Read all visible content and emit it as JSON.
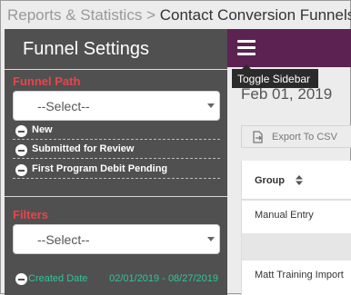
{
  "breadcrumb": {
    "parent": "Reports & Statistics",
    "separator": ">",
    "current": "Contact Conversion Funnels"
  },
  "sidebar": {
    "title": "Funnel Settings",
    "funnel_path": {
      "label": "Funnel Path",
      "select_value": "--Select--",
      "items": [
        {
          "label": "New"
        },
        {
          "label": "Submitted for Review"
        },
        {
          "label": "First Program Debit Pending"
        }
      ]
    },
    "filters": {
      "label": "Filters",
      "select_value": "--Select--",
      "items": [
        {
          "label": "Created Date",
          "value": "02/01/2019 - 08/27/2019"
        }
      ]
    }
  },
  "topbar": {
    "tooltip": "Toggle Sidebar"
  },
  "main": {
    "date_title": "Feb 01, 2019",
    "export_label": "Export To CSV",
    "table": {
      "header": "Group",
      "rows": [
        "Manual Entry",
        "",
        "Matt Training Import"
      ]
    }
  },
  "colors": {
    "sidebar_bg": "#505050",
    "topbar_bg": "#5c2252",
    "section_label": "#e8454a",
    "filter_text": "#2fc59a"
  }
}
